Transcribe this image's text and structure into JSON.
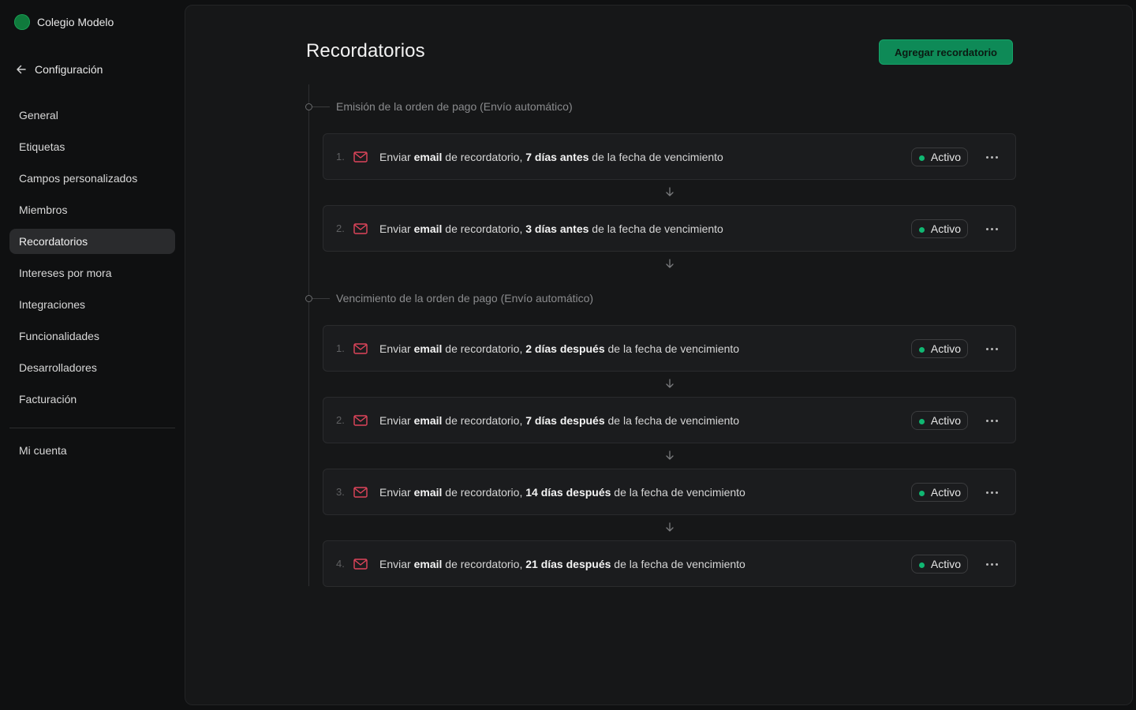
{
  "sidebar": {
    "org_name": "Colegio Modelo",
    "back_label": "Configuración",
    "items": [
      "General",
      "Etiquetas",
      "Campos personalizados",
      "Miembros",
      "Recordatorios",
      "Intereses por mora",
      "Integraciones",
      "Funcionalidades",
      "Desarrolladores",
      "Facturación"
    ],
    "active_item": "Recordatorios",
    "account_label": "Mi cuenta"
  },
  "main": {
    "title": "Recordatorios",
    "add_button": "Agregar recordatorio",
    "groups": [
      {
        "label": "Emisión de la orden de pago (Envío automático)",
        "reminders": [
          {
            "index": "1.",
            "prefix": "Enviar ",
            "channel": "email",
            "middle": " de recordatorio, ",
            "timing": "7 días antes",
            "suffix": " de la fecha de vencimiento",
            "status": "Activo"
          },
          {
            "index": "2.",
            "prefix": "Enviar ",
            "channel": "email",
            "middle": " de recordatorio, ",
            "timing": "3 días antes",
            "suffix": " de la fecha de vencimiento",
            "status": "Activo"
          }
        ]
      },
      {
        "label": "Vencimiento de la orden de pago (Envío automático)",
        "reminders": [
          {
            "index": "1.",
            "prefix": "Enviar ",
            "channel": "email",
            "middle": " de recordatorio, ",
            "timing": "2 días después",
            "suffix": " de la fecha de vencimiento",
            "status": "Activo"
          },
          {
            "index": "2.",
            "prefix": "Enviar ",
            "channel": "email",
            "middle": " de recordatorio, ",
            "timing": "7 días después",
            "suffix": " de la fecha de vencimiento",
            "status": "Activo"
          },
          {
            "index": "3.",
            "prefix": "Enviar ",
            "channel": "email",
            "middle": " de recordatorio, ",
            "timing": "14 días después",
            "suffix": " de la fecha de vencimiento",
            "status": "Activo"
          },
          {
            "index": "4.",
            "prefix": "Enviar ",
            "channel": "email",
            "middle": " de recordatorio, ",
            "timing": "21 días después",
            "suffix": " de la fecha de vencimiento",
            "status": "Activo"
          }
        ]
      }
    ]
  },
  "colors": {
    "accent": "#0e8a57",
    "status_active": "#10b772",
    "mail_icon": "#e0455b"
  },
  "icons": {
    "back": "arrow-left-icon",
    "reminder": "mail-icon",
    "more": "more-horizontal-icon",
    "connector": "arrow-down-icon"
  }
}
